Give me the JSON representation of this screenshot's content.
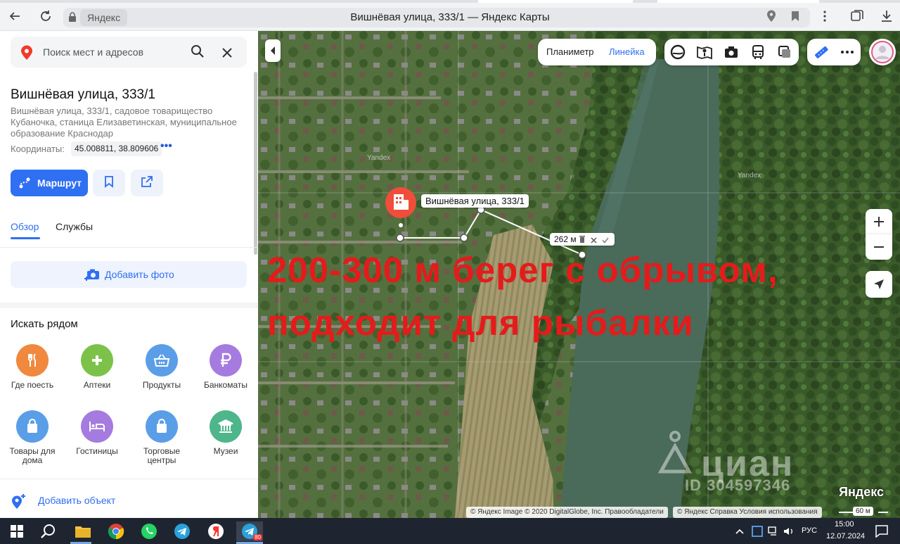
{
  "browser": {
    "host": "Яндекс",
    "page_title": "Вишнёвая улица, 333/1 — Яндекс Карты"
  },
  "search": {
    "placeholder": "Поиск мест и адресов"
  },
  "place": {
    "title": "Вишнёвая улица, 333/1",
    "address": "Вишнёвая улица, 333/1, садовое товарищество Кубаночка, станица Елизаветинская, муниципальное образование Краснодар",
    "coords_label": "Координаты:",
    "coords_value": "45.008811, 38.809606",
    "coords_more": "•••"
  },
  "actions": {
    "route_label": "Маршрут"
  },
  "tabs": [
    {
      "label": "Обзор"
    },
    {
      "label": "Службы"
    }
  ],
  "add_photo_label": "Добавить фото",
  "nearby": {
    "title": "Искать рядом",
    "categories": [
      {
        "label": "Где поесть",
        "color": "#f0883e",
        "icon": "fork-knife-icon"
      },
      {
        "label": "Аптеки",
        "color": "#7cc24a",
        "icon": "pharmacy-icon"
      },
      {
        "label": "Продукты",
        "color": "#5b9ee8",
        "icon": "basket-icon"
      },
      {
        "label": "Банкоматы",
        "color": "#a57be0",
        "icon": "ruble-icon"
      },
      {
        "label": "Товары для дома",
        "color": "#5b9ee8",
        "icon": "bag-icon"
      },
      {
        "label": "Гостиницы",
        "color": "#a57be0",
        "icon": "bed-icon"
      },
      {
        "label": "Торговые центры",
        "color": "#5b9ee8",
        "icon": "bag-icon"
      },
      {
        "label": "Музеи",
        "color": "#4fb58a",
        "icon": "museum-icon"
      }
    ]
  },
  "add_object_label": "Добавить объект",
  "map": {
    "toolbar": {
      "planimeter": "Планиметр",
      "ruler": "Линейка"
    },
    "marker_label": "Вишнёвая улица, 333/1",
    "distance_label": "262 м",
    "overlay_line1": "200-300 м берег с обрывом,",
    "overlay_line2": "подходит для рыбалки",
    "watermark_yandex_1": "Yandex",
    "watermark_yandex_2": "Yandex",
    "cian_text": "циан",
    "cian_id": "ID 304597346",
    "brand": "Яндекс",
    "attrib_left": "© Яндекс Image © 2020 DigitalGlobe, Inc.   Правообладатели",
    "attrib_right": "© Яндекс   Справка   Условия использования",
    "scale": "60 м"
  },
  "taskbar": {
    "lang": "РУС",
    "time": "15:00",
    "date": "12.07.2024",
    "telegram_badge": "80"
  }
}
